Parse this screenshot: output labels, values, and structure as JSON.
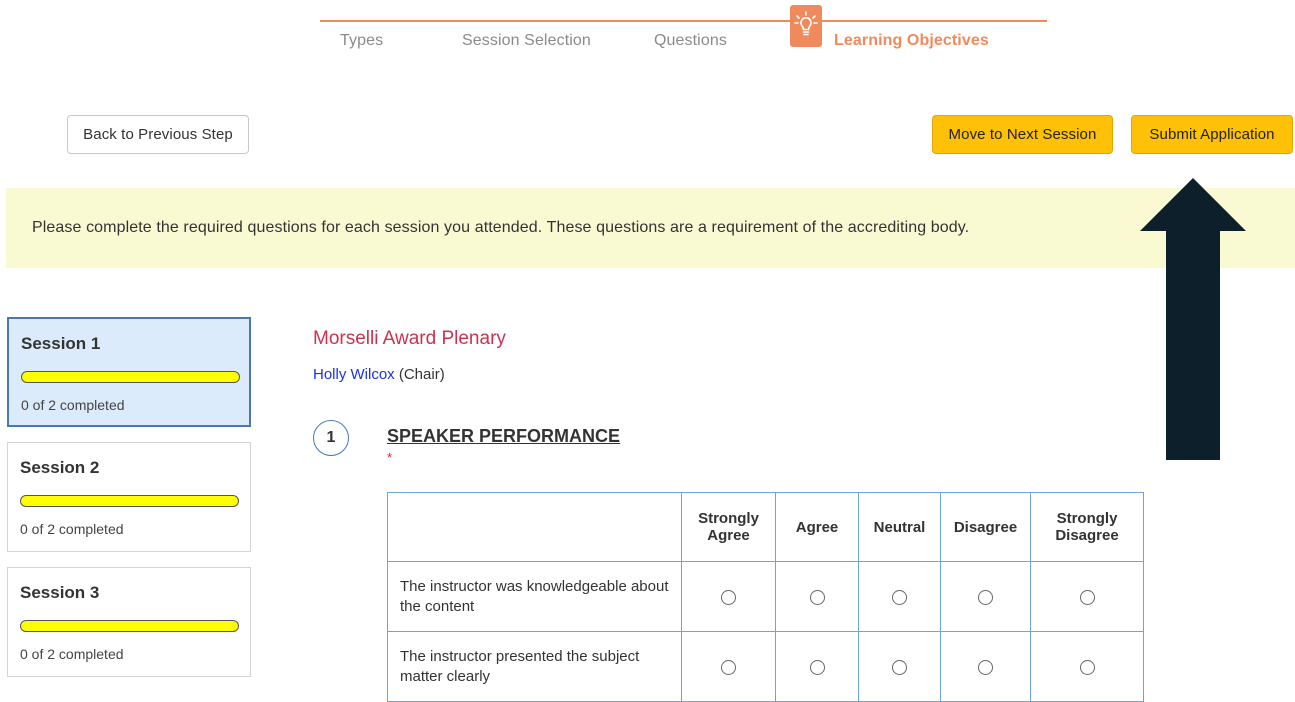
{
  "stepper": {
    "steps": [
      {
        "label": "Types",
        "state": "done"
      },
      {
        "label": "Session Selection",
        "state": "done"
      },
      {
        "label": "Questions",
        "state": "done"
      },
      {
        "label": "Learning Objectives",
        "state": "active"
      }
    ],
    "active_icon": "lightbulb-icon",
    "accent_color": "#f08a5d"
  },
  "toolbar": {
    "back_label": "Back to Previous Step",
    "next_session_label": "Move to Next Session",
    "submit_label": "Submit Application"
  },
  "notice": {
    "text": "Please complete the required questions for each session you attended.  These questions are a requirement of the accrediting body."
  },
  "sessions": [
    {
      "title": "Session 1",
      "status": "0 of 2 completed",
      "progress": 0,
      "selected": true
    },
    {
      "title": "Session 2",
      "status": "0 of 2 completed",
      "progress": 0,
      "selected": false
    },
    {
      "title": "Session 3",
      "status": "0 of 2 completed",
      "progress": 0,
      "selected": false
    }
  ],
  "main": {
    "session_name": "Morselli Award Plenary",
    "chair_name": "Holly Wilcox",
    "chair_role": "(Chair)",
    "question": {
      "number": "1",
      "title": "SPEAKER PERFORMANCE",
      "required_marker": "*",
      "columns": [
        "Strongly Agree",
        "Agree",
        "Neutral",
        "Disagree",
        "Strongly Disagree"
      ],
      "rows": [
        "The instructor was knowledgeable about the content",
        "The instructor presented the subject matter clearly"
      ]
    }
  },
  "annotation": {
    "arrow_color": "#0d1f2b",
    "arrow_direction": "up"
  }
}
